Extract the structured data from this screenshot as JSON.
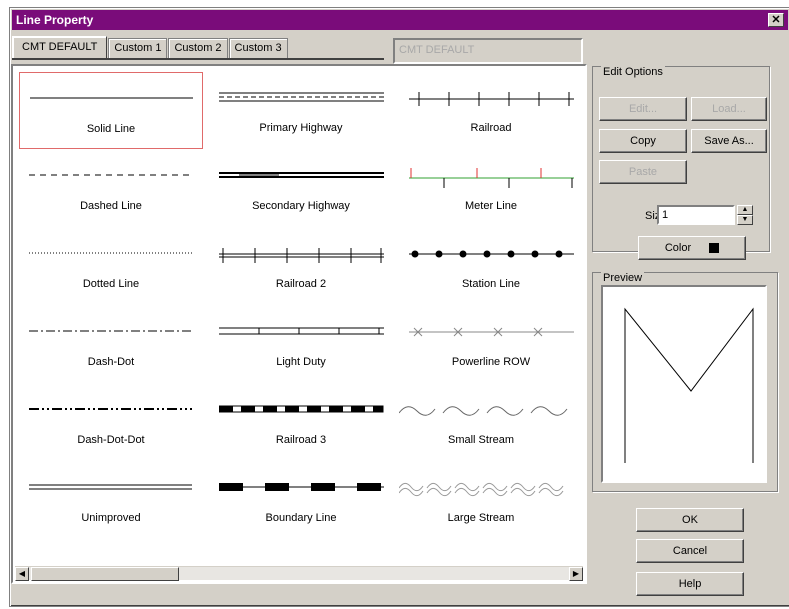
{
  "window": {
    "title": "Line Property",
    "close_glyph": "✕"
  },
  "tabs": [
    "CMT DEFAULT",
    "Custom 1",
    "Custom 2",
    "Custom 3"
  ],
  "name_field": {
    "value": "CMT DEFAULT"
  },
  "styles": [
    "Solid Line",
    "Primary Highway",
    "Railroad",
    "Dashed Line",
    "Secondary Highway",
    "Meter Line",
    "Dotted Line",
    "Railroad 2",
    "Station Line",
    "Dash-Dot",
    "Light Duty",
    "Powerline ROW",
    "Dash-Dot-Dot",
    "Railroad 3",
    "Small Stream",
    "Unimproved",
    "Boundary Line",
    "Large Stream"
  ],
  "selected_style": "Solid Line",
  "edit_options": {
    "title": "Edit Options",
    "edit": "Edit...",
    "load": "Load...",
    "copy": "Copy",
    "save_as": "Save As...",
    "paste": "Paste"
  },
  "size": {
    "label": "Size:",
    "value": "1"
  },
  "color": {
    "label": "Color",
    "swatch": "#000000"
  },
  "preview": {
    "title": "Preview"
  },
  "buttons": {
    "ok": "OK",
    "cancel": "Cancel",
    "help": "Help"
  },
  "colors": {
    "title_bar": "#7a0c7a",
    "face": "#d4d0c8",
    "selection": "#e06a6a",
    "meter_red": "#e03030",
    "meter_green": "#30a030"
  }
}
